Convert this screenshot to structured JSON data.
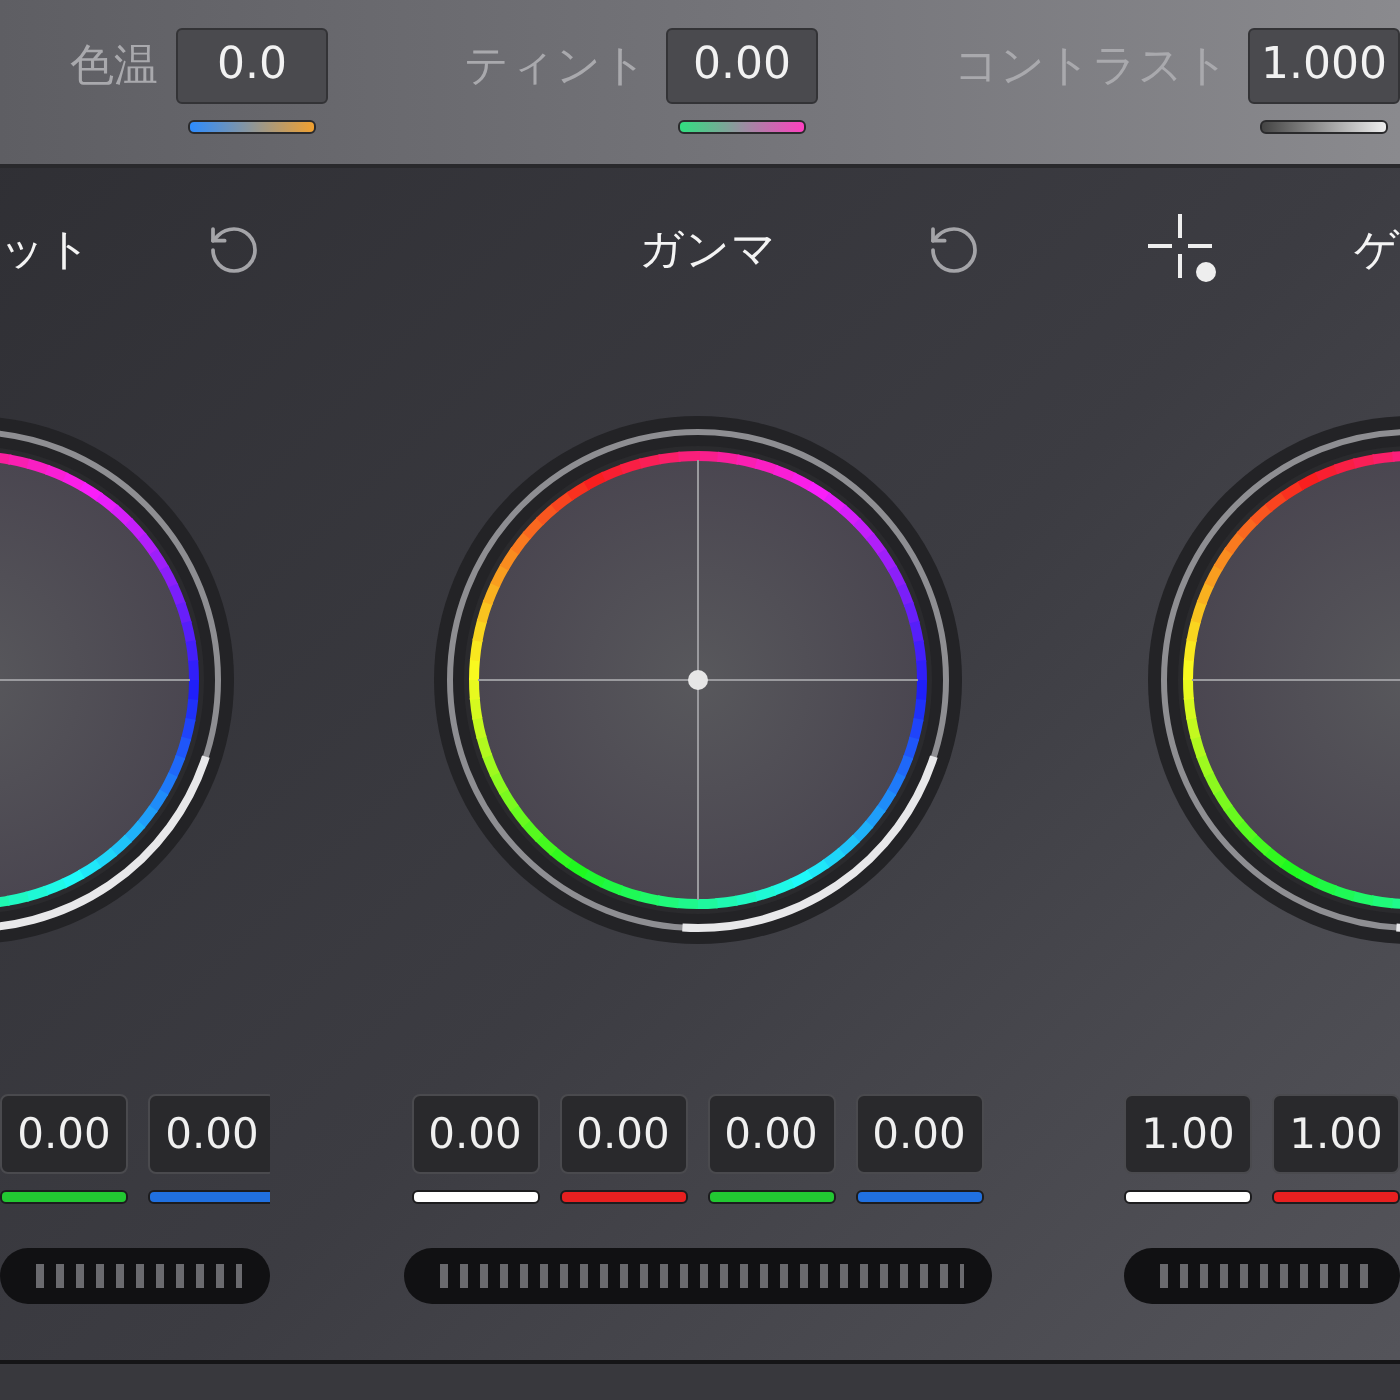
{
  "top_controls": [
    {
      "label": "色温",
      "value": "0.0",
      "kind": "temperature"
    },
    {
      "label": "ティント",
      "value": "0.00",
      "kind": "tint"
    },
    {
      "label": "コントラスト",
      "value": "1.000",
      "kind": "contrast"
    }
  ],
  "wheels": [
    {
      "title": "ット",
      "kind": "reset",
      "fields": [
        {
          "value": "0.00",
          "color": "#22c832"
        },
        {
          "value": "0.00",
          "color": "#2070e0"
        }
      ]
    },
    {
      "title": "ガンマ",
      "kind": "reset",
      "fields": [
        {
          "value": "0.00",
          "color": "#ffffff"
        },
        {
          "value": "0.00",
          "color": "#e82020"
        },
        {
          "value": "0.00",
          "color": "#22c832"
        },
        {
          "value": "0.00",
          "color": "#2070e0"
        }
      ]
    },
    {
      "title": "ゲ",
      "kind": "picker",
      "fields": [
        {
          "value": "1.00",
          "color": "#ffffff"
        },
        {
          "value": "1.00",
          "color": "#e82020"
        }
      ]
    }
  ]
}
